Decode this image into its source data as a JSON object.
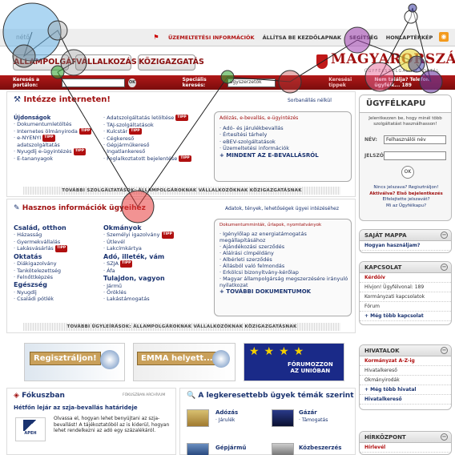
{
  "topbar": {
    "left_text": "nétő",
    "flag": "⚑",
    "links": [
      "ÜZEMELTETÉSI INFORMÁCIÓK",
      "ÁLLÍTSA BE KEZDŐLAPNAK",
      "SEGÍTSÉG",
      "HONLAPTÉRKÉP"
    ]
  },
  "header": {
    "tabs": [
      "ÁLLAMPOLGÁR",
      "VÁLLALKOZÁS",
      "KÖZIGAZGATÁS"
    ],
    "logo": "MAGYARORSZÁG.HU",
    "logo_sub": "ÜGYFÉLSZOLGÁLATI PORTÁL"
  },
  "searchbar": {
    "label1": "Keresés a portálon:",
    "ok": "OK",
    "label2": "Speciális keresés:",
    "select": "ügyszerzetők",
    "link": "Keresési tippek",
    "right": "Nem találja? Telefon ügyfélk... 189"
  },
  "intezze": {
    "title": "Intézze interneten!",
    "link": "Sorbanállás nélkül",
    "col1": [
      "Újdonságok",
      "Dokumentumletöltés",
      "Internetes ölmányiroda",
      "e-NYENYI",
      "adatszolgáltatás",
      "Nyugdíj e-ügyintézés",
      "E-tananyagok"
    ],
    "col2": [
      "Adatszolgáltatás letöltése",
      "TAJ-szolgáltatások",
      "Kulcstár",
      "Cégkereső",
      "Gépjárműkereső",
      "Ingatlankereső",
      "Foglalkoztatott bejelentése"
    ],
    "box_title": "Adózás, e-bevallás, e-ügyintézés",
    "box_items": [
      "Adó- és járulékbevallás",
      "Értesítési tárhely",
      "eBEV-szolgáltatások",
      "Üzemeltetési információk"
    ],
    "box_more": "+ MINDENT AZ E-BEVALLÁSRÓL",
    "more": "TOVÁBBI SZOLGÁLTATÁSOK: ÁLLAMPOLGÁROKNAK  VÁLLALKOZÓKNAK  KÖZIGAZGATÁSNAK"
  },
  "hasznos": {
    "title": "Hasznos információk ügyeihez",
    "link": "Adatok, tények, lehetőségek ügyei intézéséhez",
    "c1": [
      {
        "h": "Család, otthon",
        "items": [
          "Házasság",
          "Gyermekvállalás",
          "Lakásvásárlás"
        ]
      },
      {
        "h": "Oktatás",
        "items": [
          "Diákigazolvány",
          "Tankötelezettség",
          "Felnőttképzés"
        ]
      },
      {
        "h": "Egészség",
        "items": [
          "Nyugdíj",
          "Családi pótlék"
        ]
      }
    ],
    "c2": [
      {
        "h": "Okmányok",
        "items": [
          "Személyi igazolvány",
          "Útlevél",
          "Lakcímkártya"
        ]
      },
      {
        "h": "Adó, illeték, vám",
        "items": [
          "SZJA",
          "Áfa"
        ]
      },
      {
        "h": "Tulajdon, vagyon",
        "items": [
          "Jármű",
          "Öröklés",
          "Lakástámogatás"
        ]
      }
    ],
    "box_title": "Dokumentumminták, űrlapok, nyomtatványok",
    "box_items": [
      "Igénylőlap az energiatámogatás megállapításához",
      "Ajándékozási szerződés",
      "Aláírási címpéldány",
      "Albérleti szerződés",
      "Állásból való felmondás",
      "Erkölcsi bizonyítvány-kérőlap",
      "Magyar állampolgárság megszerzésére irányuló nyilatkozat"
    ],
    "box_more": "+ TOVÁBBI DOKUMENTUMOK",
    "more": "TOVÁBBI ÜGYLEÍRÁSOK: ÁLLAMPOLGÁROKNAK  VÁLLALKOZÓKNAK  KÖZIGAZGATÁSNAK"
  },
  "banners": {
    "b1": "Regisztráljon!",
    "b2": "EMMA helyett...",
    "b3a": "FÓRUMOZZON",
    "b3b": "AZ UNIÓBAN"
  },
  "fokusz": {
    "title": "Fókuszban",
    "archive": "FÓKUSZBAN ARCHÍVUM",
    "headline": "Hétfőn lejár az szja-bevallás határideje",
    "body": "Olvassa el, hogyan lehet benyújtani az szja-bevallást! A tájékoztatóból az is kiderül, hogyan lehet rendelkezni az adó egy százalékáról.",
    "apeh": "APEH"
  },
  "legkeresettebb": {
    "title": "A legkeresettebb ügyek témák szerint",
    "items": [
      {
        "h": "Adózás",
        "s": "Járulék"
      },
      {
        "h": "Gázár",
        "s": "Támogatás"
      },
      {
        "h": "Gépjármű",
        "s": ""
      },
      {
        "h": "Közbeszerzés",
        "s": ""
      }
    ]
  },
  "ugyfelkapu": {
    "title": "ÜGYFÉLKAPU",
    "intro": "Jelentkezzen be, hogy minél több szolgáltatást használhasson!",
    "name_label": "NÉV:",
    "name_value": "Felhasználói név",
    "pw_label": "JELSZÓ:",
    "ok": "OK",
    "reg1": "Nincs jelszava? Regisztráljon!",
    "reg2": "Aktiválva? Első bejelentkezés",
    "reg3": "Elfelejtette jelszavát?",
    "reg4": "Mi az Ügyfélkapu?"
  },
  "sajat": {
    "title": "SAJÁT MAPPA",
    "item": "Hogyan használjam?"
  },
  "kapcsolat": {
    "title": "KAPCSOLAT",
    "items": [
      "Kérdőív",
      "Hívjon! Ügyfélvonal: 189",
      "Kormányzati kapcsolatok",
      "Fórum"
    ],
    "more": "+ Még több kapcsolat"
  },
  "hivatalok": {
    "title": "HIVATALOK",
    "items": [
      "Kormányzat A-Z-ig",
      "Hivatalkereső",
      "Okmányirodák"
    ],
    "more": "+ Még több hivatal",
    "last": "Hivatalkereső"
  },
  "hirkozpont": {
    "title": "HÍRKÖZPONT",
    "item": "Hírlevél"
  }
}
